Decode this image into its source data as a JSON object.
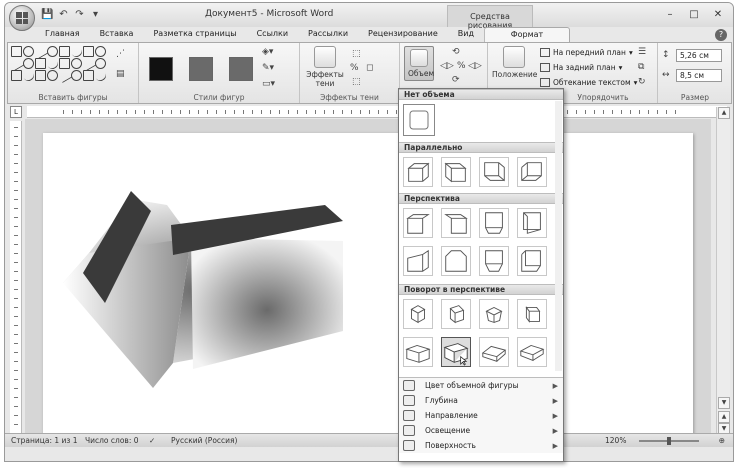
{
  "window": {
    "title": "Документ5 - Microsoft Word",
    "context_tab_title": "Средства рисования",
    "controls": {
      "minimize": "–",
      "maximize": "□",
      "close": "✕"
    }
  },
  "quick_access": {
    "save": "💾",
    "undo": "↶",
    "redo": "↷",
    "customize": "▾"
  },
  "tabs": [
    {
      "label": "Главная"
    },
    {
      "label": "Вставка"
    },
    {
      "label": "Разметка страницы"
    },
    {
      "label": "Ссылки"
    },
    {
      "label": "Рассылки"
    },
    {
      "label": "Рецензирование"
    },
    {
      "label": "Вид"
    },
    {
      "label": "Формат"
    }
  ],
  "ribbon": {
    "groups": {
      "insert_shapes": "Вставить фигуры",
      "shape_styles": "Стили фигур",
      "shadow_effects": "Эффекты тени",
      "arrange": "Упорядочить",
      "size": "Размер"
    },
    "buttons": {
      "shadow_effects_line1": "Эффекты",
      "shadow_effects_line2": "тени",
      "volume": "Объем",
      "position": "Положение",
      "bring_front": "На передний план",
      "send_back": "На задний план",
      "text_wrap": "Обтекание текстом"
    },
    "size": {
      "height": "5,26 см",
      "width": "8,5 см"
    },
    "style_swatches": [
      "#111111",
      "#6a6a6a",
      "#6a6a6a"
    ]
  },
  "volume_gallery": {
    "sections": {
      "none": "Нет объема",
      "parallel": "Параллельно",
      "perspective": "Перспектива",
      "rotation": "Поворот в перспективе"
    },
    "menu": [
      {
        "label": "Цвет объемной фигуры"
      },
      {
        "label": "Глубина"
      },
      {
        "label": "Направление"
      },
      {
        "label": "Освещение"
      },
      {
        "label": "Поверхность"
      }
    ]
  },
  "status": {
    "page": "Страница: 1 из 1",
    "words": "Число слов: 0",
    "language": "Русский (Россия)",
    "zoom": "120%"
  }
}
